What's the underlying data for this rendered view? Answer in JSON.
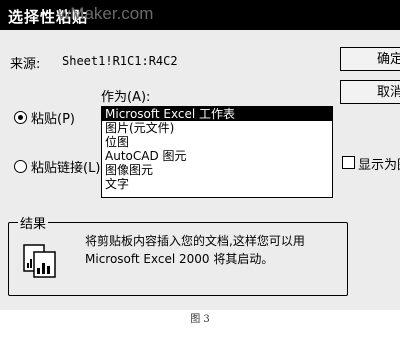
{
  "window": {
    "title": "选择性粘贴",
    "watermark": "wMaker.com"
  },
  "source": {
    "label": "来源:",
    "value": "Sheet1!R1C1:R4C2"
  },
  "buttons": {
    "ok": "确定",
    "cancel": "取消"
  },
  "as_label": "作为(A):",
  "options": {
    "paste": "粘贴(P)",
    "paste_link": "粘贴链接(L)",
    "paste_selected": true
  },
  "list": [
    "Microsoft Excel 工作表",
    "图片(元文件)",
    "位图",
    "AutoCAD 图元",
    "图像图元",
    "文字"
  ],
  "list_selected_index": 0,
  "display_as_icon": {
    "label": "显示为图",
    "checked": false
  },
  "result": {
    "title": "结果",
    "line1": "将剪贴板内容插入您的文档,这样您可以用",
    "line2": "Microsoft Excel 2000 将其启动。"
  },
  "caption": "图 3"
}
